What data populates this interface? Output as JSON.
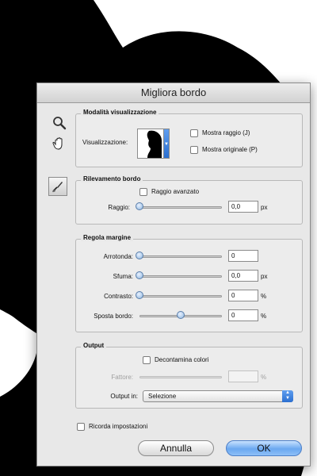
{
  "dialog": {
    "title": "Migliora bordo"
  },
  "tools": [
    {
      "name": "zoom-tool",
      "icon": "magnifier-icon"
    },
    {
      "name": "hand-tool",
      "icon": "hand-icon"
    },
    {
      "name": "refine-radius-tool",
      "icon": "brush-icon"
    }
  ],
  "view_mode": {
    "legend": "Modalità visualizzazione",
    "view_label": "Visualizzazione:",
    "show_radius": {
      "label": "Mostra raggio (J)",
      "checked": false
    },
    "show_original": {
      "label": "Mostra originale (P)",
      "checked": false
    }
  },
  "edge_detection": {
    "legend": "Rilevamento bordo",
    "smart_radius": {
      "label": "Raggio avanzato",
      "checked": false
    },
    "radius": {
      "label": "Raggio:",
      "value": "0,0",
      "unit": "px",
      "level": 0
    }
  },
  "adjust_edge": {
    "legend": "Regola margine",
    "smooth": {
      "label": "Arrotonda:",
      "value": "0",
      "unit": "",
      "level": 0
    },
    "feather": {
      "label": "Sfuma:",
      "value": "0,0",
      "unit": "px",
      "level": 0
    },
    "contrast": {
      "label": "Contrasto:",
      "value": "0",
      "unit": "%",
      "level": 0
    },
    "shift_edge": {
      "label": "Sposta bordo:",
      "value": "0",
      "unit": "%",
      "level": 0.5
    }
  },
  "output": {
    "legend": "Output",
    "decontaminate": {
      "label": "Decontamina colori",
      "checked": false
    },
    "amount": {
      "label": "Fattore:",
      "value": "",
      "unit": "%"
    },
    "output_to": {
      "label": "Output in:",
      "selected": "Selezione"
    }
  },
  "remember": {
    "label": "Ricorda impostazioni",
    "checked": false
  },
  "buttons": {
    "cancel": "Annulla",
    "ok": "OK"
  },
  "colors": {
    "accent": "#3a7de0",
    "background_silhouette": "#000000"
  }
}
